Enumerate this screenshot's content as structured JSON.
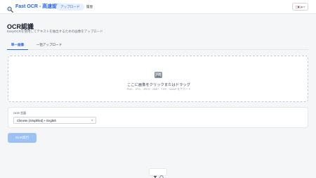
{
  "header": {
    "brand_title": "Fast OCR - 高速認識",
    "nav_upload": "アップロード",
    "nav_history": "履歴",
    "language_code": "ja",
    "language_chevron": "▾"
  },
  "page": {
    "title": "OCR認識",
    "subtitle": "EasyOCRを使用してテキストを抽出するための画像をアップロード"
  },
  "tabs": [
    {
      "label": "単一画像",
      "active": true
    },
    {
      "label": "一括アップロード",
      "active": false
    }
  ],
  "dropzone": {
    "label": "ここに画像をクリックまたはドラッグ",
    "hint": "PNG、JPG、JPEG、BMP、TIFF、WebP をサポート"
  },
  "ocr_language": {
    "label": "OCR 言語",
    "selected": "Chinese (Simplified) + English",
    "chevron": "▾"
  },
  "run_button": {
    "label": "OCR実行"
  },
  "colors": {
    "accent": "#2563eb",
    "accent_light": "#e8effc",
    "button_disabled": "#9ec1f5",
    "background": "#f5f6f8"
  },
  "icons": [
    "magnifier-icon",
    "flag-japan-icon",
    "image-icon",
    "filter-icon",
    "record-icon"
  ]
}
